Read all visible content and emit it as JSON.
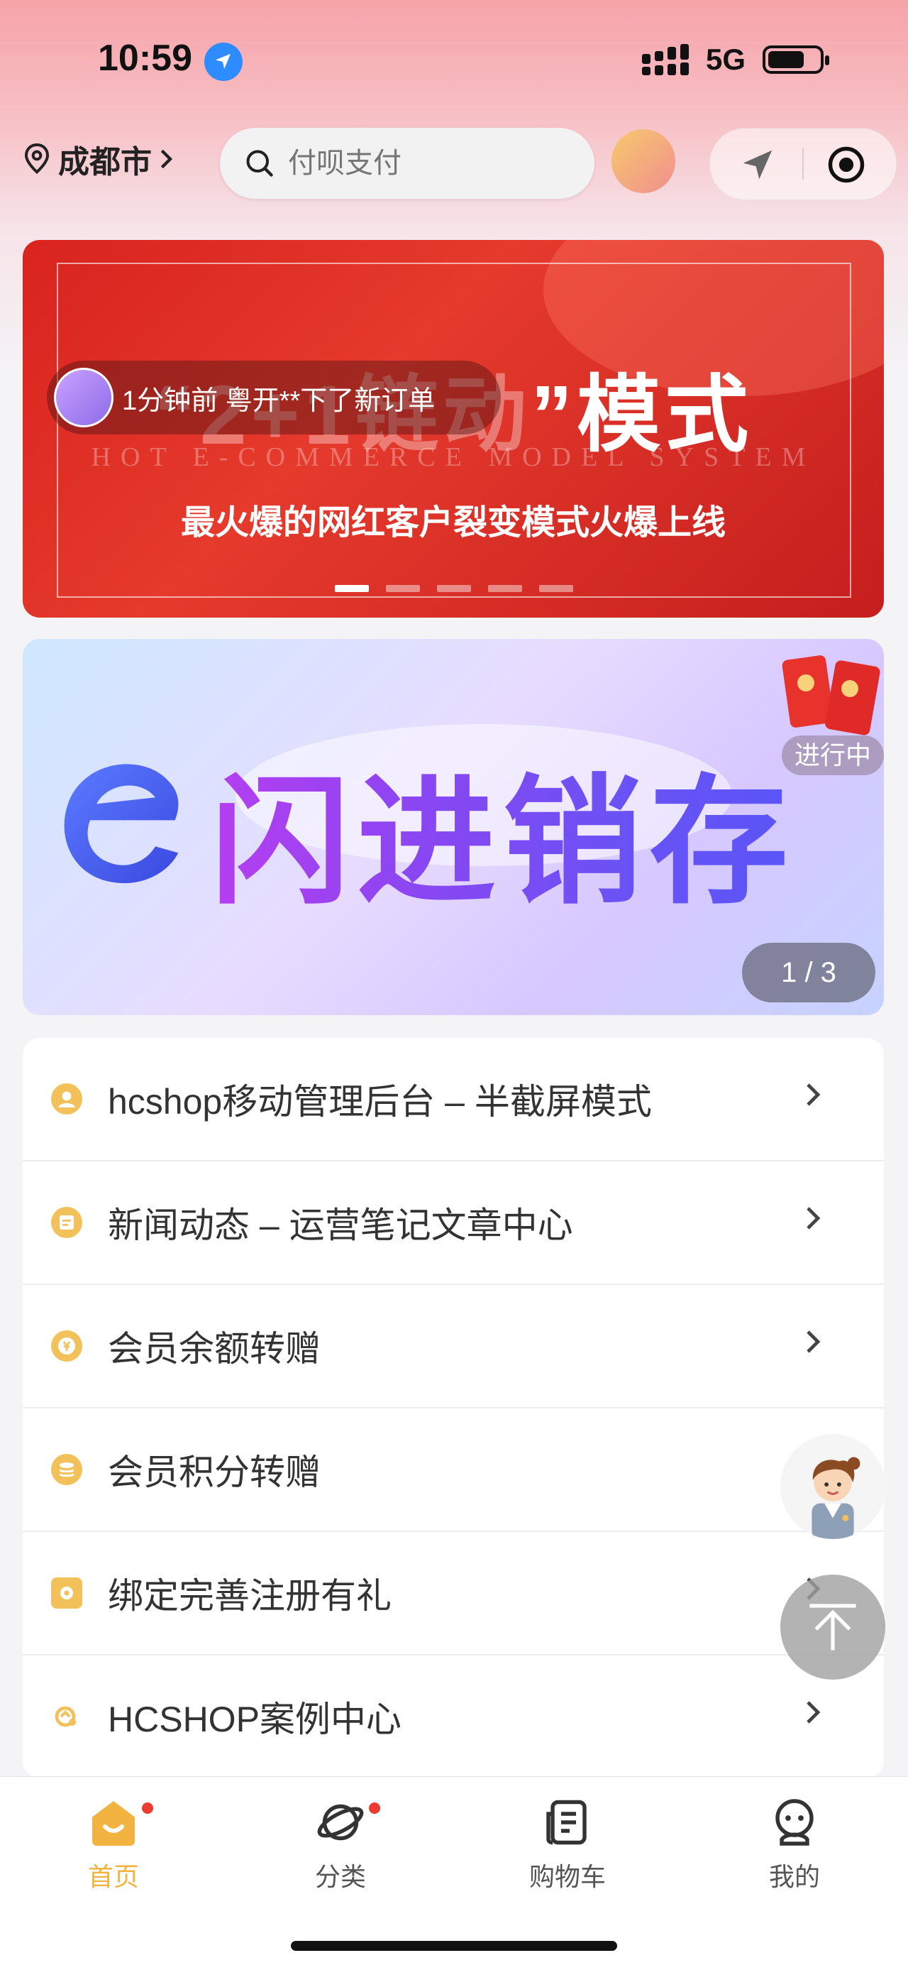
{
  "status_bar": {
    "time": "10:59",
    "network": "5G"
  },
  "header": {
    "city": "成都市",
    "search_placeholder": "付呗支付"
  },
  "banner_main": {
    "headline_part1": "“2+1",
    "headline_part2": "链动",
    "headline_part3": "”模式",
    "subtitle_en": "HOT E-COMMERCE MODEL SYSTEM",
    "subtitle": "最火爆的网红客户裂变模式火爆上线",
    "dots_total": 5,
    "dots_active": 1
  },
  "notice_ticker": {
    "text": "1分钟前 粤开**下了新订单"
  },
  "promo_banner": {
    "brand": "闪进销存",
    "status_label": "进行中",
    "pager": "1 / 3"
  },
  "menu": {
    "items": [
      {
        "label": "hcshop移动管理后台 – 半截屏模式",
        "icon": "user-badge-icon"
      },
      {
        "label": "新闻动态 – 运营笔记文章中心",
        "icon": "news-icon"
      },
      {
        "label": "会员余额转赠",
        "icon": "yen-coin-icon"
      },
      {
        "label": "会员积分转赠",
        "icon": "points-stack-icon"
      },
      {
        "label": "绑定完善注册有礼",
        "icon": "gift-icon"
      },
      {
        "label": "HCSHOP案例中心",
        "icon": "case-icon"
      }
    ]
  },
  "tabbar": {
    "items": [
      {
        "label": "首页",
        "active": true,
        "dot": true
      },
      {
        "label": "分类",
        "active": false,
        "dot": true
      },
      {
        "label": "购物车",
        "active": false,
        "dot": false
      },
      {
        "label": "我的",
        "active": false,
        "dot": false
      }
    ]
  },
  "colors": {
    "accent": "#f2b340",
    "banner_red": "#d9231f",
    "badge_red": "#ee3b2f"
  }
}
